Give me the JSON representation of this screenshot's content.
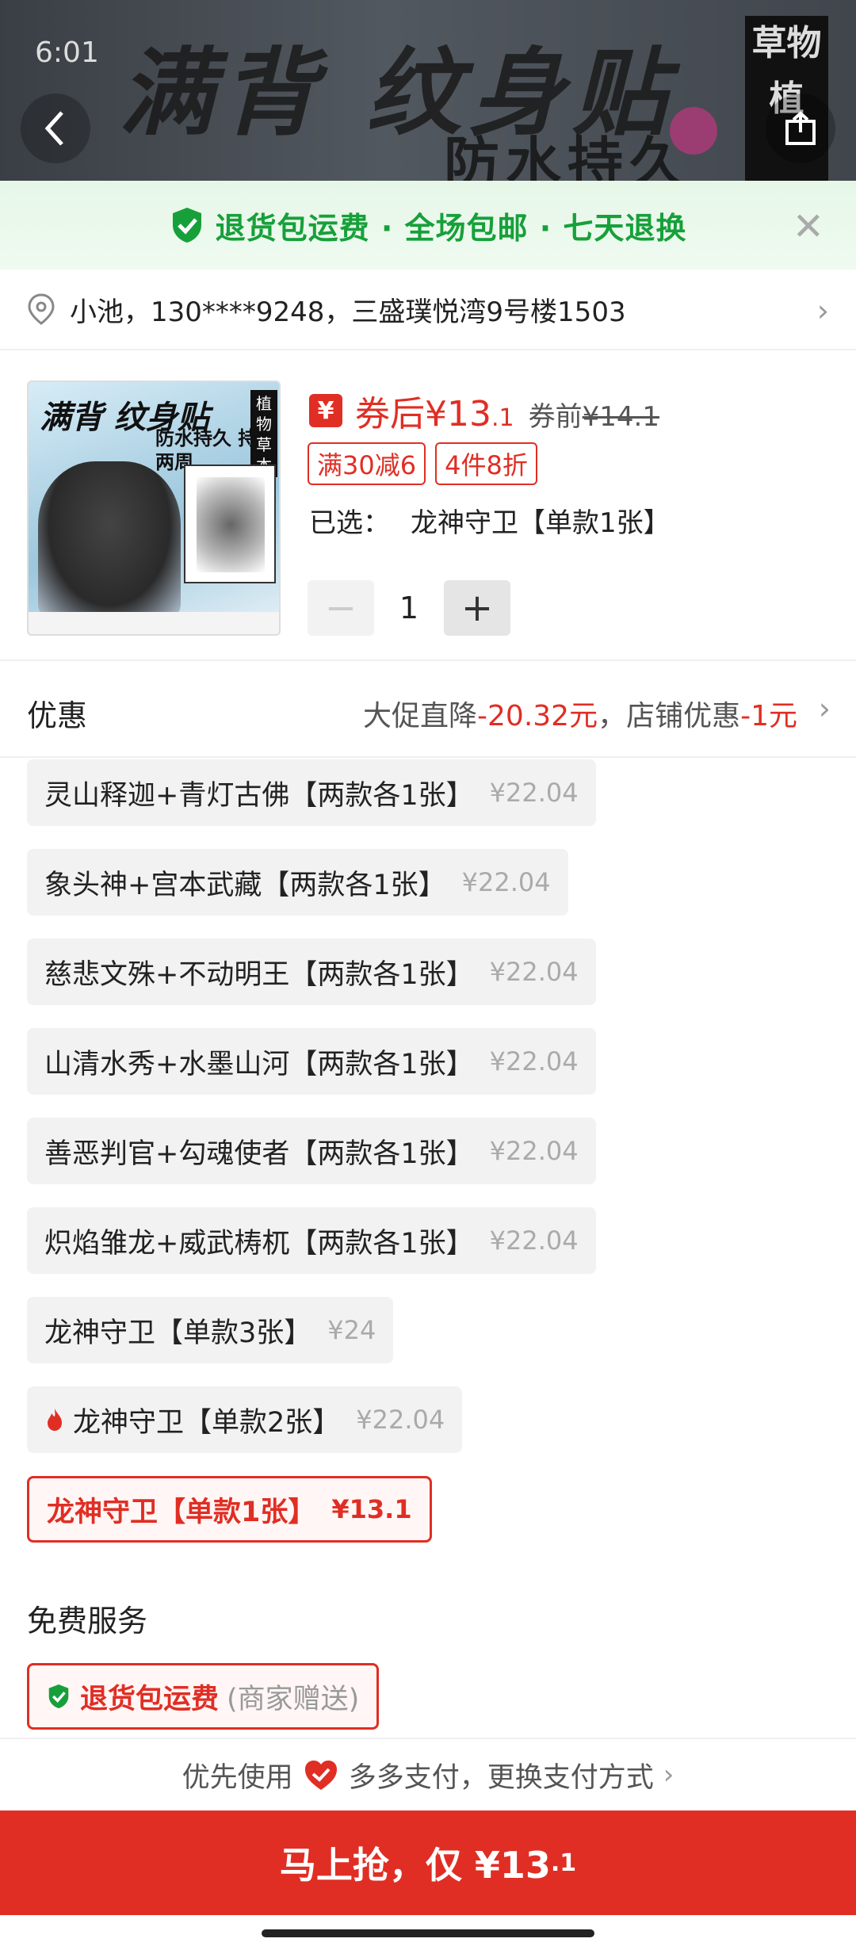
{
  "status_bar": {
    "time": "6:01"
  },
  "banner": {
    "title": "满背 纹身贴",
    "subtitle": "防水持久",
    "side_text": "草物植"
  },
  "guarantee": {
    "text": "退货包运费 · 全场包邮 · 七天退换"
  },
  "address": {
    "text": "小池，130****9248，三盛璞悦湾9号楼1503"
  },
  "product": {
    "thumb_title": "满背 纹身贴",
    "thumb_sub": "防水持久 持久两周",
    "thumb_side": "植物草本",
    "coupon_icon": "¥",
    "price_after_label": "券后¥13",
    "price_after_decimal": ".1",
    "price_before_label": "券前",
    "price_before_value": "¥14.1",
    "tags": [
      "满30减6",
      "4件8折"
    ],
    "selected_label": "已选：",
    "selected_value": "龙神守卫【单款1张】",
    "quantity": "1",
    "minus": "−",
    "plus": "+"
  },
  "discount": {
    "label": "优惠",
    "text1": "大促直降",
    "value1": "-20.32元",
    "sep": "，店铺优惠",
    "value2": "-1元"
  },
  "sku_options": [
    {
      "name": "灵山释迦+青灯古佛【两款各1张】",
      "price": "¥22.04"
    },
    {
      "name": "象头神+宫本武藏【两款各1张】",
      "price": "¥22.04"
    },
    {
      "name": "慈悲文殊+不动明王【两款各1张】",
      "price": "¥22.04"
    },
    {
      "name": "山清水秀+水墨山河【两款各1张】",
      "price": "¥22.04"
    },
    {
      "name": "善恶判官+勾魂使者【两款各1张】",
      "price": "¥22.04"
    },
    {
      "name": "炽焰雏龙+威武梼杌【两款各1张】",
      "price": "¥22.04"
    },
    {
      "name": "龙神守卫【单款3张】",
      "price": "¥24"
    },
    {
      "name": "龙神守卫【单款2张】",
      "price": "¥22.04"
    },
    {
      "name": "龙神守卫【单款1张】",
      "price": "¥13.1"
    }
  ],
  "free_service": {
    "title": "免费服务",
    "text": "退货包运费",
    "note": "(商家赠送)"
  },
  "payment": {
    "prefix": "优先使用",
    "text": "多多支付，更换支付方式"
  },
  "buy": {
    "label": "马上抢，仅 ¥13",
    "decimal": ".1"
  },
  "colors": {
    "accent": "#e02e24",
    "green": "#17a03a"
  }
}
